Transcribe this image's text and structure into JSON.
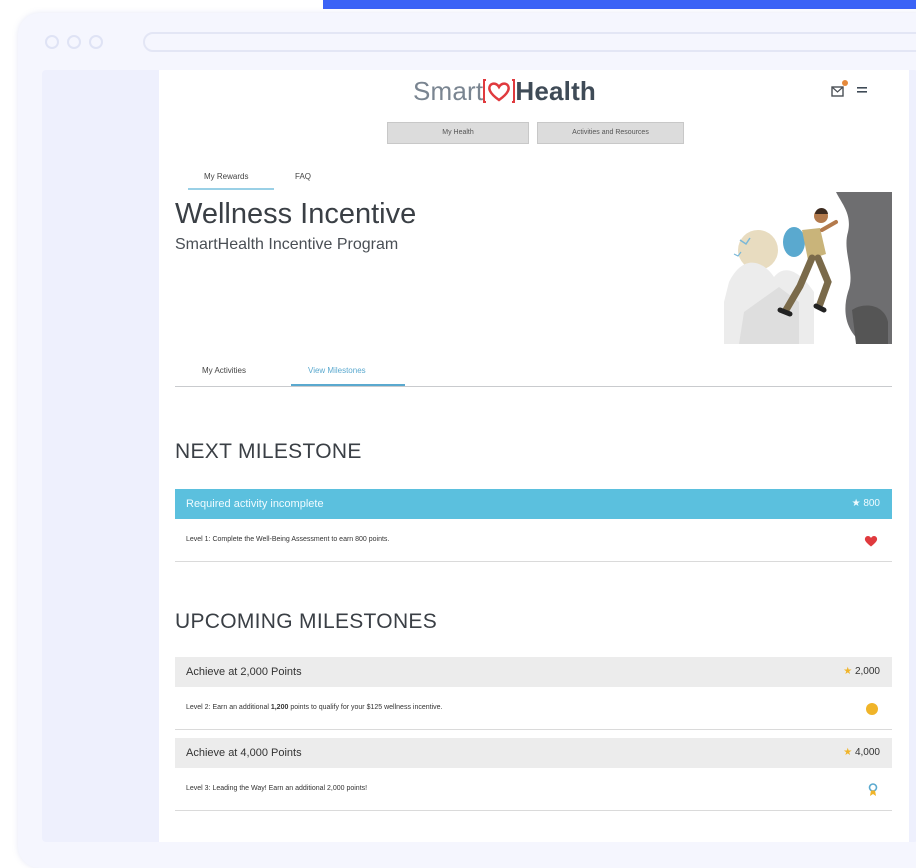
{
  "colors": {
    "accent": "#3b63f6",
    "milestone_header": "#5bc0de",
    "tab_active": "#5aa9cf",
    "heart": "#e03a3e",
    "gold": "#f0b429"
  },
  "header": {
    "logo_left": "Smart",
    "logo_right": "Health",
    "mail_icon": "mail-notification-icon",
    "menu_icon": "hamburger-menu-icon"
  },
  "nav": {
    "buttons": [
      {
        "label": "My Health"
      },
      {
        "label": "Activities and Resources"
      }
    ]
  },
  "top_tabs": [
    {
      "label": "My Rewards",
      "active": true
    },
    {
      "label": "FAQ",
      "active": false
    }
  ],
  "hero": {
    "title": "Wellness Incentive",
    "subtitle": "SmartHealth Incentive Program"
  },
  "sub_tabs": [
    {
      "label": "My Activities",
      "active": false
    },
    {
      "label": "View Milestones",
      "active": true
    }
  ],
  "next_milestone": {
    "heading": "NEXT MILESTONE",
    "status": "Required activity incomplete",
    "points": "800",
    "description": "Level 1: Complete the Well-Being Assessment to earn 800 points.",
    "icon": "heart-icon"
  },
  "upcoming": {
    "heading": "UPCOMING MILESTONES",
    "items": [
      {
        "title": "Achieve at 2,000 Points",
        "points": "2,000",
        "desc_pre": "Level 2: Earn an additional ",
        "desc_bold": "1,200",
        "desc_post": " points to qualify for your $125 wellness incentive.",
        "icon": "coin-icon"
      },
      {
        "title": "Achieve at 4,000 Points",
        "points": "4,000",
        "desc_pre": "Level 3: Leading the Way! Earn an additional 2,000 points!",
        "desc_bold": "",
        "desc_post": "",
        "icon": "award-ribbon-icon"
      }
    ]
  }
}
